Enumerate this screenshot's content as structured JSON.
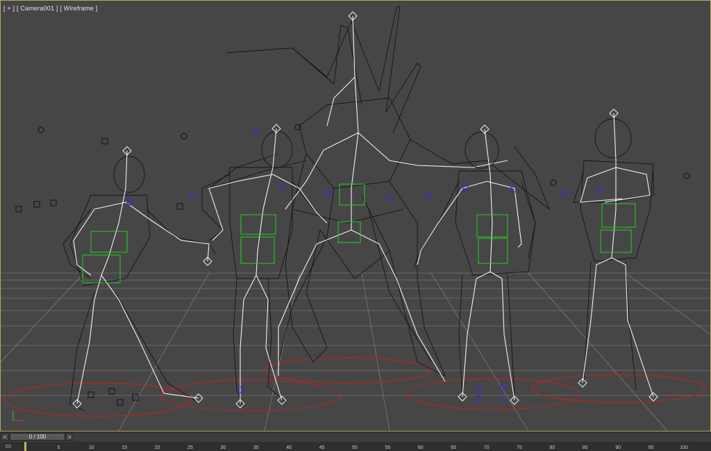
{
  "viewport": {
    "label_parts": [
      "[ + ]",
      "[ Camera001 ]",
      "[ Wireframe ]"
    ]
  },
  "timeslider": {
    "frame_label": "0 / 100",
    "prev_symbol": "<",
    "next_symbol": ">"
  },
  "trackbar": {
    "ticks": [
      "5",
      "10",
      "15",
      "20",
      "25",
      "30",
      "35",
      "40",
      "45",
      "50",
      "55",
      "60",
      "65",
      "70",
      "75",
      "80",
      "85",
      "90",
      "95",
      "100"
    ]
  },
  "colors": {
    "viewport_bg": "#464646",
    "wire": "#141414",
    "bone": "#f2f2f2",
    "helper_box": "#22d022",
    "ground_circle": "#c82020",
    "marker": "#3a2ad8",
    "border_accent": "#b9a66a"
  }
}
